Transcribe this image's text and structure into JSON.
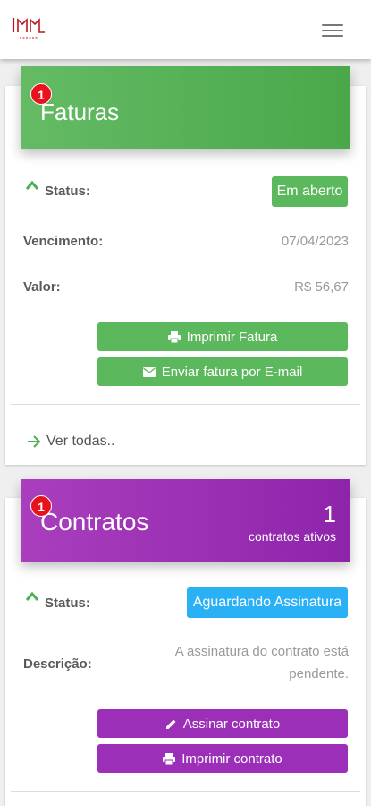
{
  "colors": {
    "green": "#5cb85c",
    "purple": "#9c2fb8",
    "blue_status": "#2ab0f5",
    "badge_red": "#e8121e"
  },
  "app": {
    "logo_icon": "company-logo-icon",
    "menu_icon": "hamburger-menu-icon"
  },
  "faturas": {
    "badge": "1",
    "title": "Faturas",
    "status_label": "Status:",
    "status_value": "Em aberto",
    "vencimento_label": "Vencimento:",
    "vencimento_value": "07/04/2023",
    "valor_label": "Valor:",
    "valor_value": "R$ 56,67",
    "print_button": "Imprimir Fatura",
    "email_button": "Enviar fatura por E-mail",
    "see_all": "Ver todas.."
  },
  "contratos": {
    "badge": "1",
    "title": "Contratos",
    "count": "1",
    "count_label": "contratos ativos",
    "status_label": "Status:",
    "status_value": "Aguardando Assinatura",
    "descricao_label": "Descrição:",
    "descricao_line1": "A assinatura do contrato está",
    "descricao_line2": "pendente.",
    "sign_button": "Assinar contrato",
    "print_button": "Imprimir contrato"
  }
}
